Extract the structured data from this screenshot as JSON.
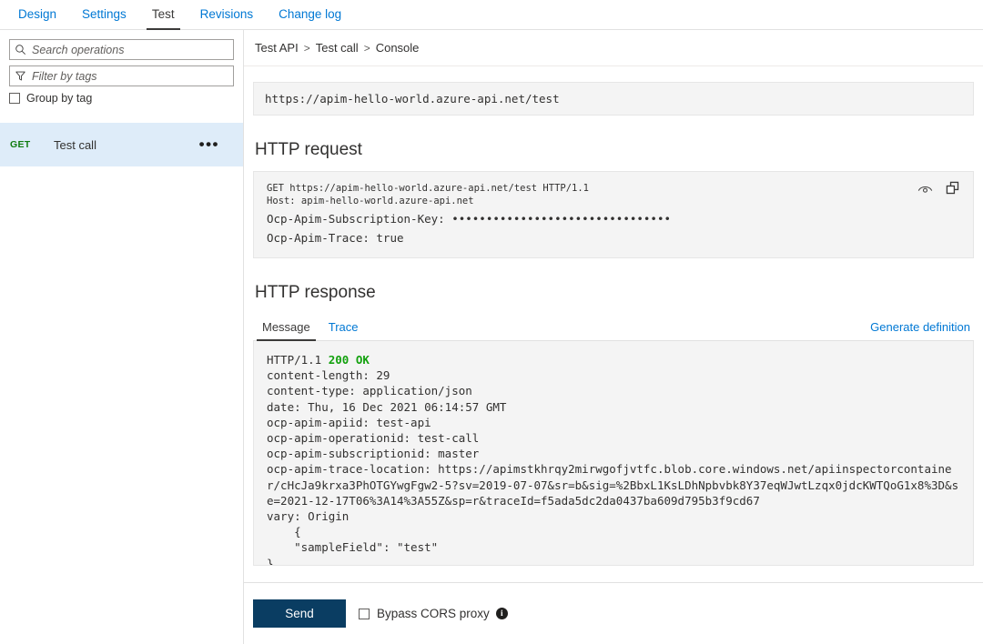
{
  "top_tabs": [
    {
      "label": "Design",
      "active": false
    },
    {
      "label": "Settings",
      "active": false
    },
    {
      "label": "Test",
      "active": true
    },
    {
      "label": "Revisions",
      "active": false
    },
    {
      "label": "Change log",
      "active": false
    }
  ],
  "sidebar": {
    "search": {
      "placeholder": "Search operations",
      "value": "",
      "icon": "search-icon"
    },
    "filter": {
      "placeholder": "Filter by tags",
      "value": "",
      "icon": "funnel-icon"
    },
    "group_by_tag": {
      "label": "Group by tag",
      "checked": false
    },
    "operations": [
      {
        "verb": "GET",
        "name": "Test call",
        "selected": true,
        "menu": "•••"
      }
    ]
  },
  "breadcrumb": {
    "items": [
      "Test API",
      "Test call",
      "Console"
    ],
    "separator": ">"
  },
  "url_bar": {
    "value": "https://apim-hello-world.azure-api.net/test"
  },
  "http_request": {
    "title": "HTTP request",
    "line_request": "GET https://apim-hello-world.azure-api.net/test HTTP/1.1",
    "line_host": "Host: apim-hello-world.azure-api.net",
    "line_subscription_key": "Ocp-Apim-Subscription-Key: ••••••••••••••••••••••••••••••••",
    "line_trace": "Ocp-Apim-Trace: true",
    "icons": {
      "reveal": "eye-icon",
      "copy": "copy-icon"
    }
  },
  "http_response": {
    "title": "HTTP response",
    "tabs": [
      {
        "label": "Message",
        "active": true
      },
      {
        "label": "Trace",
        "active": false
      }
    ],
    "generate_definition": "Generate definition",
    "status_prefix": "HTTP/1.1 ",
    "status_code": "200 OK",
    "body": "content-length: 29\ncontent-type: application/json\ndate: Thu, 16 Dec 2021 06:14:57 GMT\nocp-apim-apiid: test-api\nocp-apim-operationid: test-call\nocp-apim-subscriptionid: master\nocp-apim-trace-location: https://apimstkhrqy2mirwgofjvtfc.blob.core.windows.net/apiinspectorcontainer/cHcJa9krxa3PhOTGYwgFgw2-5?sv=2019-07-07&sr=b&sig=%2BbxL1KsLDhNpbvbk8Y37eqWJwtLzqx0jdcKWTQoG1x8%3D&se=2021-12-17T06%3A14%3A55Z&sp=r&traceId=f5ada5dc2da0437ba609d795b3f9cd67\nvary: Origin\n    {\n    \"sampleField\": \"test\"\n}"
  },
  "footer": {
    "send_label": "Send",
    "bypass_cors": {
      "label": "Bypass CORS proxy",
      "checked": false
    },
    "info_icon_glyph": "i"
  },
  "colors": {
    "link": "#0078d4",
    "selected_row": "#deecf9",
    "verb_get": "#107c10",
    "status_ok": "#13a10e",
    "send_button": "#0a3d62",
    "panel_bg": "#f4f4f4"
  }
}
